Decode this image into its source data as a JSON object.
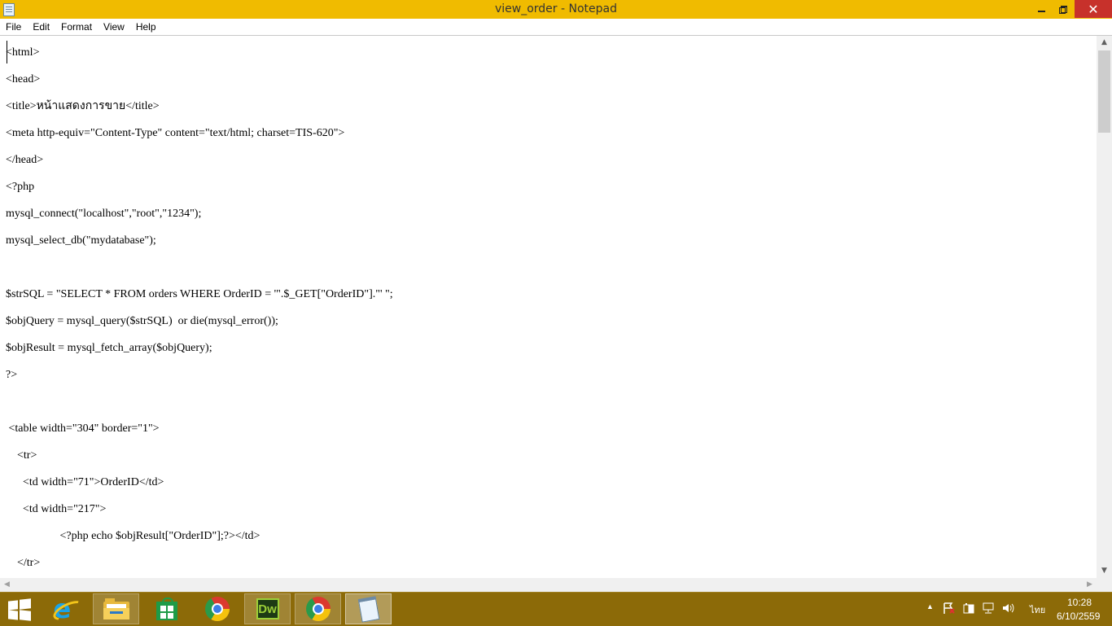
{
  "window": {
    "title": "view_order - Notepad",
    "close_glyph": "✕"
  },
  "menu": [
    "File",
    "Edit",
    "Format",
    "View",
    "Help"
  ],
  "editor": {
    "lines": [
      "<html>",
      "<head>",
      "<title>หน้าแสดงการขาย</title>",
      "<meta http-equiv=\"Content-Type\" content=\"text/html; charset=TIS-620\">",
      "</head>",
      "<?php",
      "mysql_connect(\"localhost\",\"root\",\"1234\");",
      "mysql_select_db(\"mydatabase\");",
      "",
      "$strSQL = \"SELECT * FROM orders WHERE OrderID = '\".$_GET[\"OrderID\"].\"' \";",
      "$objQuery = mysql_query($strSQL)  or die(mysql_error());",
      "$objResult = mysql_fetch_array($objQuery);",
      "?>",
      "",
      " <table width=\"304\" border=\"1\">",
      "    <tr>",
      "      <td width=\"71\">OrderID</td>",
      "      <td width=\"217\">",
      "                   <?php echo $objResult[\"OrderID\"];?></td>",
      "    </tr>"
    ]
  },
  "scroll": {
    "up": "▲",
    "down": "▼",
    "left": "◀",
    "right": "▶"
  },
  "taskbar": {
    "apps": [
      {
        "name": "internet-explorer-icon"
      },
      {
        "name": "file-explorer-icon"
      },
      {
        "name": "store-icon"
      },
      {
        "name": "chrome-icon"
      },
      {
        "name": "dreamweaver-icon",
        "label": "Dw"
      },
      {
        "name": "chrome-icon"
      },
      {
        "name": "notepad-icon"
      }
    ],
    "tray": {
      "show_hidden": "▲",
      "language": "ไทย",
      "time": "10:28",
      "date": "6/10/2559"
    }
  },
  "colors": {
    "titlebar": "#f0bb00",
    "taskbar": "#8c6a08",
    "close_button": "#c7312b"
  }
}
